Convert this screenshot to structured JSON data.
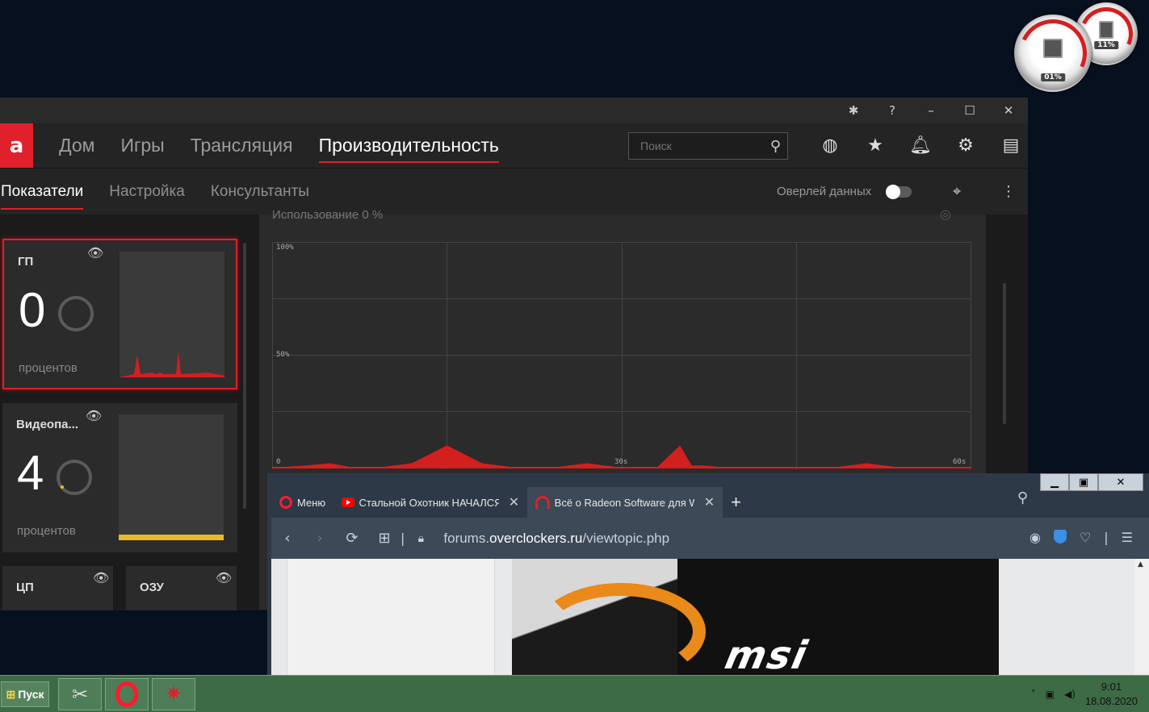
{
  "gadget": {
    "cpu_pct": "01%",
    "ram_pct": "11%"
  },
  "amd": {
    "logo": "a",
    "titlebar_icons": [
      "bug-icon",
      "help-icon",
      "minimize-icon",
      "maximize-icon",
      "close-icon"
    ],
    "nav": [
      "Дом",
      "Игры",
      "Трансляция",
      "Производительность"
    ],
    "search_placeholder": "Поиск",
    "subnav": [
      "Показатели",
      "Настройка",
      "Консультанты"
    ],
    "overlay_label": "Оверлей данных",
    "cards": {
      "gpu": {
        "title": "ГП",
        "value": "0",
        "units": "процентов"
      },
      "vram": {
        "title": "Видеопа...",
        "value": "4",
        "units": "процентов"
      },
      "cpu": {
        "title": "ЦП"
      },
      "ram": {
        "title": "ОЗУ"
      }
    },
    "usage_label": "Использование   0 %",
    "chart": {
      "y_top": "100%",
      "y_mid": "50%",
      "x_start": "0",
      "x_mid": "30s",
      "x_end": "60s"
    }
  },
  "chart_data": {
    "type": "area",
    "x": [
      0,
      3,
      5,
      6,
      7,
      9,
      12,
      15,
      18,
      21,
      24,
      27,
      30,
      33,
      35,
      36,
      37,
      39,
      42,
      45,
      48,
      51,
      54,
      57,
      60
    ],
    "values": [
      0,
      1,
      2,
      1,
      0,
      0,
      2,
      10,
      2,
      0,
      0,
      2,
      0,
      0,
      10,
      1,
      1,
      0,
      0,
      0,
      0,
      2,
      0,
      0,
      0
    ],
    "y_labels": [
      "100%",
      "50%",
      "0"
    ],
    "x_labels": [
      "0",
      "30s",
      "60s"
    ],
    "ylim": [
      0,
      100
    ],
    "xlim": [
      0,
      60
    ],
    "grid": true,
    "color": "#d41f1f"
  },
  "browser": {
    "tabs": [
      {
        "label": "Меню"
      },
      {
        "label": "Стальной Охотник НАЧАЛСЯ"
      },
      {
        "label": "Всё о Radeon Software для W"
      }
    ],
    "url_prefix": "forums.",
    "url_domain": "overclockers.ru",
    "url_path": "/viewtopic.php",
    "page_brand": "msi"
  },
  "taskbar": {
    "start_label": "Пуск",
    "time": "9:01",
    "date": "18.08.2020"
  }
}
